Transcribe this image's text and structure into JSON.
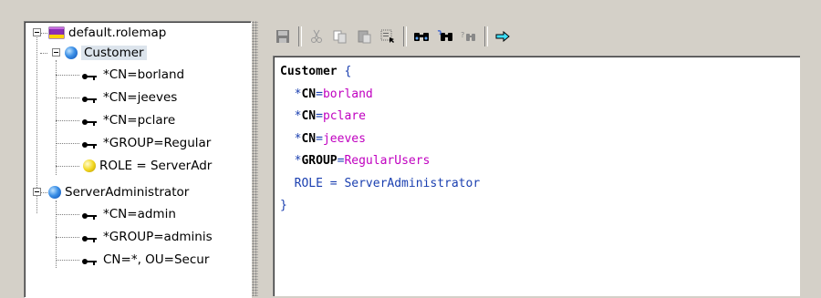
{
  "tree": {
    "root": {
      "label": "default.rolemap"
    },
    "nodes": [
      {
        "type": "role",
        "label": "Customer",
        "selected": true
      },
      {
        "type": "member",
        "label": "*CN=borland"
      },
      {
        "type": "member",
        "label": "*CN=jeeves"
      },
      {
        "type": "member",
        "label": "*CN=pclare"
      },
      {
        "type": "member",
        "label": "*GROUP=Regular"
      },
      {
        "type": "role-ref",
        "label": "ROLE = ServerAdr"
      },
      {
        "type": "role",
        "label": "ServerAdministrator",
        "selected": false
      },
      {
        "type": "member",
        "label": "*CN=admin"
      },
      {
        "type": "member",
        "label": "*GROUP=adminis"
      },
      {
        "type": "member",
        "label": "CN=*, OU=Secur"
      }
    ]
  },
  "toolbar": {
    "buttons": [
      "save-icon",
      "cut-icon",
      "copy-icon",
      "paste-icon",
      "select-all-icon",
      "find-icon",
      "find-replace-icon",
      "find-next-icon",
      "goto-icon"
    ]
  },
  "editor": {
    "role_name": "Customer",
    "open_brace": "{",
    "close_brace": "}",
    "entries": [
      {
        "star": "*",
        "key": "CN",
        "eq": "=",
        "value": "borland"
      },
      {
        "star": "*",
        "key": "CN",
        "eq": "=",
        "value": "pclare"
      },
      {
        "star": "*",
        "key": "CN",
        "eq": "=",
        "value": "jeeves"
      },
      {
        "star": "*",
        "key": "GROUP",
        "eq": "=",
        "value": "RegularUsers"
      }
    ],
    "role_line": "ROLE = ServerAdministrator"
  },
  "colors": {
    "background": "#d4d0c8",
    "value": "#c000c0",
    "brace": "#1a3fb0"
  }
}
